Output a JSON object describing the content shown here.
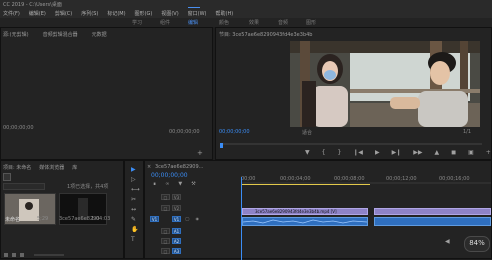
{
  "app": {
    "title": "CC 2019 - C:\\Users\\桌面",
    "menus": [
      "文件(F)",
      "编辑(E)",
      "剪辑(C)",
      "序列(S)",
      "标记(M)",
      "图形(G)",
      "视图(V)",
      "窗口(W)",
      "帮助(H)"
    ]
  },
  "workspaces": [
    "学习",
    "组件",
    "编辑",
    "颜色",
    "效果",
    "音频",
    "图形"
  ],
  "active_workspace": "编辑",
  "source": {
    "tabs": [
      "源:(无剪辑)",
      "音频剪辑混合器",
      "元数据"
    ],
    "timecode_left": "00;00;00;00",
    "timecode_right": "00;00;00;00"
  },
  "program": {
    "title": "节目: 3ce57ae6e8290943fd4e3e3b4b",
    "timecode": "00;00;00;00",
    "fit": "适合",
    "fraction": "1/1"
  },
  "project": {
    "tabs": [
      "项目: 未命名",
      "媒体浏览器",
      "库"
    ],
    "info": "1项已选择，共4项",
    "items": [
      {
        "name": "未命名",
        "duration": "5;29"
      },
      {
        "name": "3ce57ae6e8290",
        "duration": "1:04:03"
      }
    ]
  },
  "timeline": {
    "tab": "3ce57ae6e82909...",
    "timecode": "00;00;00;00",
    "ruler": [
      "00;00",
      "00;00;04;00",
      "00;00;08;00",
      "00;00;12;00",
      "00;00;16;00"
    ],
    "video_tracks": [
      "V3",
      "V2",
      "V1"
    ],
    "audio_tracks": [
      "A1",
      "A2",
      "A3"
    ],
    "clip_label": "3ce57ae6e8290943fd4e3e3b4b.mp4 [V]"
  },
  "badge": "84%",
  "colors": {
    "accent": "#3b8df5",
    "clip_video": "#8e83c7",
    "clip_audio": "#2f6fbf"
  }
}
